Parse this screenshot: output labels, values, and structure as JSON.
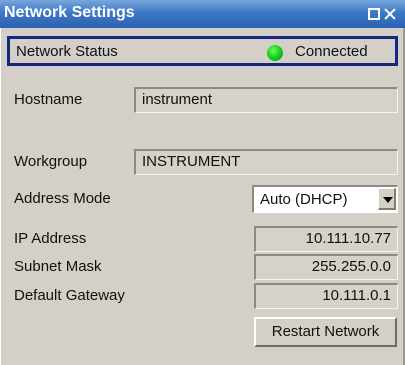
{
  "window": {
    "title": "Network Settings"
  },
  "status": {
    "label": "Network Status",
    "value": "Connected",
    "indicator_color": "#1ad41f"
  },
  "hostname": {
    "label": "Hostname",
    "value": "instrument"
  },
  "workgroup": {
    "label": "Workgroup",
    "value": "INSTRUMENT"
  },
  "address_mode": {
    "label": "Address Mode",
    "value": "Auto (DHCP)"
  },
  "ip_address": {
    "label": "IP Address",
    "value": "10.111.10.77"
  },
  "subnet_mask": {
    "label": "Subnet Mask",
    "value": "255.255.0.0"
  },
  "default_gateway": {
    "label": "Default Gateway",
    "value": "10.111.0.1"
  },
  "restart_button": {
    "label": "Restart Network"
  },
  "colors": {
    "titlebar": "#3c78c6",
    "status_border": "#15267d",
    "background": "#d4d0c8"
  }
}
